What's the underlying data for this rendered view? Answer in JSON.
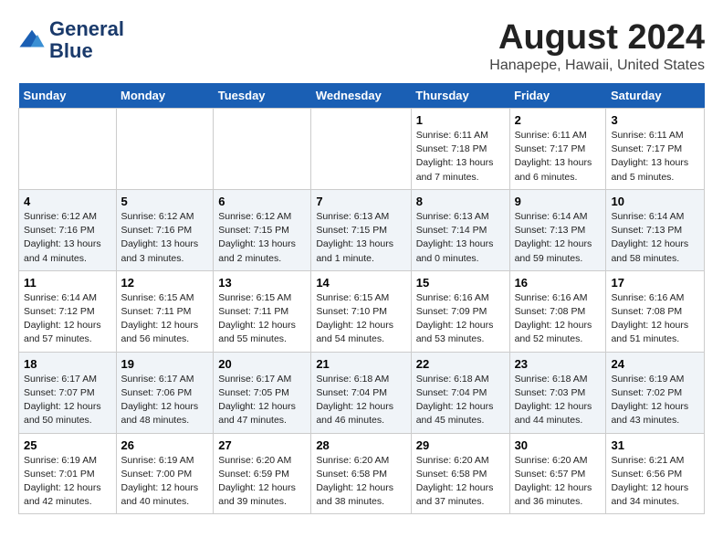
{
  "header": {
    "logo_line1": "General",
    "logo_line2": "Blue",
    "main_title": "August 2024",
    "subtitle": "Hanapepe, Hawaii, United States"
  },
  "days_of_week": [
    "Sunday",
    "Monday",
    "Tuesday",
    "Wednesday",
    "Thursday",
    "Friday",
    "Saturday"
  ],
  "weeks": [
    [
      {
        "day": "",
        "info": ""
      },
      {
        "day": "",
        "info": ""
      },
      {
        "day": "",
        "info": ""
      },
      {
        "day": "",
        "info": ""
      },
      {
        "day": "1",
        "info": "Sunrise: 6:11 AM\nSunset: 7:18 PM\nDaylight: 13 hours\nand 7 minutes."
      },
      {
        "day": "2",
        "info": "Sunrise: 6:11 AM\nSunset: 7:17 PM\nDaylight: 13 hours\nand 6 minutes."
      },
      {
        "day": "3",
        "info": "Sunrise: 6:11 AM\nSunset: 7:17 PM\nDaylight: 13 hours\nand 5 minutes."
      }
    ],
    [
      {
        "day": "4",
        "info": "Sunrise: 6:12 AM\nSunset: 7:16 PM\nDaylight: 13 hours\nand 4 minutes."
      },
      {
        "day": "5",
        "info": "Sunrise: 6:12 AM\nSunset: 7:16 PM\nDaylight: 13 hours\nand 3 minutes."
      },
      {
        "day": "6",
        "info": "Sunrise: 6:12 AM\nSunset: 7:15 PM\nDaylight: 13 hours\nand 2 minutes."
      },
      {
        "day": "7",
        "info": "Sunrise: 6:13 AM\nSunset: 7:15 PM\nDaylight: 13 hours\nand 1 minute."
      },
      {
        "day": "8",
        "info": "Sunrise: 6:13 AM\nSunset: 7:14 PM\nDaylight: 13 hours\nand 0 minutes."
      },
      {
        "day": "9",
        "info": "Sunrise: 6:14 AM\nSunset: 7:13 PM\nDaylight: 12 hours\nand 59 minutes."
      },
      {
        "day": "10",
        "info": "Sunrise: 6:14 AM\nSunset: 7:13 PM\nDaylight: 12 hours\nand 58 minutes."
      }
    ],
    [
      {
        "day": "11",
        "info": "Sunrise: 6:14 AM\nSunset: 7:12 PM\nDaylight: 12 hours\nand 57 minutes."
      },
      {
        "day": "12",
        "info": "Sunrise: 6:15 AM\nSunset: 7:11 PM\nDaylight: 12 hours\nand 56 minutes."
      },
      {
        "day": "13",
        "info": "Sunrise: 6:15 AM\nSunset: 7:11 PM\nDaylight: 12 hours\nand 55 minutes."
      },
      {
        "day": "14",
        "info": "Sunrise: 6:15 AM\nSunset: 7:10 PM\nDaylight: 12 hours\nand 54 minutes."
      },
      {
        "day": "15",
        "info": "Sunrise: 6:16 AM\nSunset: 7:09 PM\nDaylight: 12 hours\nand 53 minutes."
      },
      {
        "day": "16",
        "info": "Sunrise: 6:16 AM\nSunset: 7:08 PM\nDaylight: 12 hours\nand 52 minutes."
      },
      {
        "day": "17",
        "info": "Sunrise: 6:16 AM\nSunset: 7:08 PM\nDaylight: 12 hours\nand 51 minutes."
      }
    ],
    [
      {
        "day": "18",
        "info": "Sunrise: 6:17 AM\nSunset: 7:07 PM\nDaylight: 12 hours\nand 50 minutes."
      },
      {
        "day": "19",
        "info": "Sunrise: 6:17 AM\nSunset: 7:06 PM\nDaylight: 12 hours\nand 48 minutes."
      },
      {
        "day": "20",
        "info": "Sunrise: 6:17 AM\nSunset: 7:05 PM\nDaylight: 12 hours\nand 47 minutes."
      },
      {
        "day": "21",
        "info": "Sunrise: 6:18 AM\nSunset: 7:04 PM\nDaylight: 12 hours\nand 46 minutes."
      },
      {
        "day": "22",
        "info": "Sunrise: 6:18 AM\nSunset: 7:04 PM\nDaylight: 12 hours\nand 45 minutes."
      },
      {
        "day": "23",
        "info": "Sunrise: 6:18 AM\nSunset: 7:03 PM\nDaylight: 12 hours\nand 44 minutes."
      },
      {
        "day": "24",
        "info": "Sunrise: 6:19 AM\nSunset: 7:02 PM\nDaylight: 12 hours\nand 43 minutes."
      }
    ],
    [
      {
        "day": "25",
        "info": "Sunrise: 6:19 AM\nSunset: 7:01 PM\nDaylight: 12 hours\nand 42 minutes."
      },
      {
        "day": "26",
        "info": "Sunrise: 6:19 AM\nSunset: 7:00 PM\nDaylight: 12 hours\nand 40 minutes."
      },
      {
        "day": "27",
        "info": "Sunrise: 6:20 AM\nSunset: 6:59 PM\nDaylight: 12 hours\nand 39 minutes."
      },
      {
        "day": "28",
        "info": "Sunrise: 6:20 AM\nSunset: 6:58 PM\nDaylight: 12 hours\nand 38 minutes."
      },
      {
        "day": "29",
        "info": "Sunrise: 6:20 AM\nSunset: 6:58 PM\nDaylight: 12 hours\nand 37 minutes."
      },
      {
        "day": "30",
        "info": "Sunrise: 6:20 AM\nSunset: 6:57 PM\nDaylight: 12 hours\nand 36 minutes."
      },
      {
        "day": "31",
        "info": "Sunrise: 6:21 AM\nSunset: 6:56 PM\nDaylight: 12 hours\nand 34 minutes."
      }
    ]
  ]
}
